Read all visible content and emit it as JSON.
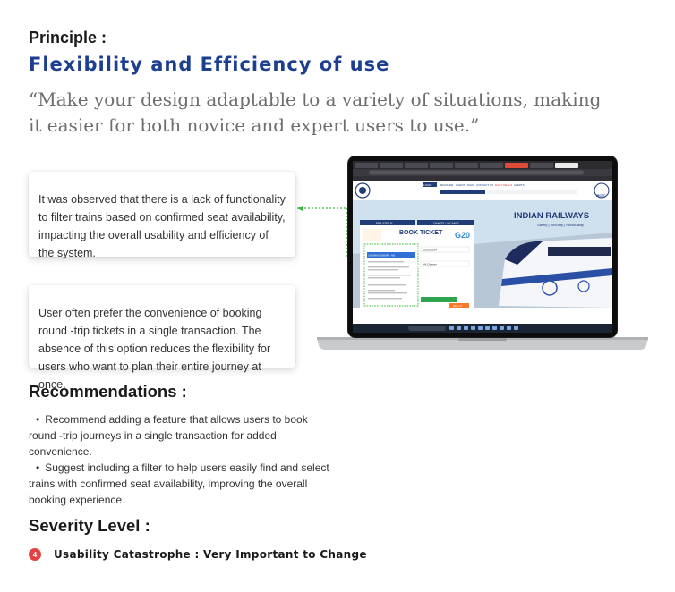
{
  "principle": {
    "label": "Principle :",
    "title": "Flexibility and Efficiency of use",
    "quote": "“Make your design adaptable to a variety of situations, making it easier for both novice and expert users to use.”"
  },
  "observations": [
    {
      "text": "It was observed that there is a lack of functionality to filter trains based on confirmed seat availability, impacting the overall usability and efficiency of the system."
    },
    {
      "text": "User often prefer the convenience of booking round -trip tickets in a single transaction. The absence of this option reduces the flexibility for users who want to plan their entire journey at once."
    }
  ],
  "screenshot": {
    "banner_title": "INDIAN RAILWAYS",
    "banner_subtitle": "Safety | Security | Punctuality",
    "book_ticket": "BOOK TICKET",
    "pnr_status": "PNR STATUS",
    "charts_vacancy": "CHARTS / VACANCY",
    "date": "22/01/2024",
    "class_option": "All Classes",
    "search_button": "Search",
    "brand": "IRCTC",
    "g20": "G20",
    "nav_items": [
      "LOGIN",
      "REGISTER",
      "AGENT LOGIN",
      "CONTACT US",
      "DAILY DEALS",
      "ALERTS"
    ],
    "from_option": "CHENNAI EGMORE - MS",
    "colors": {
      "accent": "#213d77",
      "highlight": "#fb792b",
      "dashed_connector": "#3cb93c"
    }
  },
  "recommendations": {
    "heading": "Recommendations :",
    "items": [
      "Recommend adding a feature that allows users to book round -trip journeys in a single transaction for added convenience.",
      "Suggest including a filter to help users easily find and select trains with confirmed seat availability, improving the overall booking experience."
    ],
    "bullet": "•"
  },
  "severity": {
    "heading": "Severity Level :",
    "level": "4",
    "text": "Usability Catastrophe : Very Important to Change",
    "color": "#e54141"
  }
}
